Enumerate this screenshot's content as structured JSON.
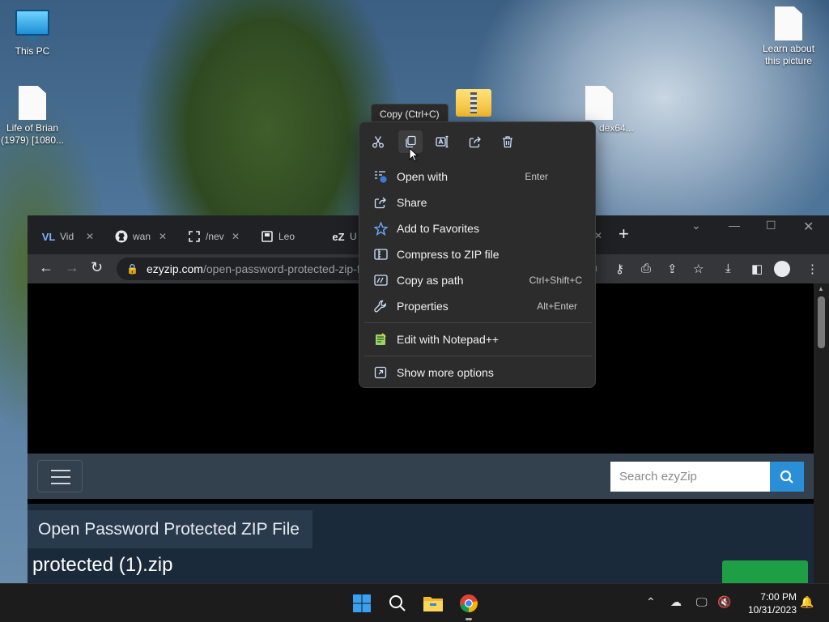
{
  "desktop": {
    "icons": [
      {
        "label": "This PC"
      },
      {
        "label": "Life of Brian (1979) [1080..."
      },
      {
        "label": "dex64..."
      },
      {
        "label": "Learn about this picture"
      }
    ]
  },
  "tooltip": "Copy (Ctrl+C)",
  "context_menu": {
    "quick_actions": [
      "cut-icon",
      "copy-icon",
      "rename-icon",
      "share-icon",
      "delete-icon"
    ],
    "items": [
      {
        "label": "Open with",
        "shortcut": "Enter"
      },
      {
        "label": "Share",
        "shortcut": ""
      },
      {
        "label": "Add to Favorites",
        "shortcut": ""
      },
      {
        "label": "Compress to ZIP file",
        "shortcut": ""
      },
      {
        "label": "Copy as path",
        "shortcut": "Ctrl+Shift+C"
      },
      {
        "label": "Properties",
        "shortcut": "Alt+Enter"
      },
      {
        "label": "Edit with Notepad++",
        "shortcut": ""
      },
      {
        "label": "Show more options",
        "shortcut": ""
      }
    ]
  },
  "browser": {
    "tabs": [
      {
        "favicon": "VL",
        "label": "Vid"
      },
      {
        "favicon": "github-icon",
        "label": "wan"
      },
      {
        "favicon": "expand-icon",
        "label": "/nev"
      },
      {
        "favicon": "doc-icon",
        "label": "Leo"
      },
      {
        "favicon": "eZ",
        "label": "U"
      }
    ],
    "url_host": "ezyzip.com",
    "url_path": "/open-password-protected-zip-f",
    "site": {
      "search_placeholder": "Search ezyZip",
      "title": "Open Password Protected ZIP File",
      "subtitle": "protected (1).zip"
    }
  },
  "taskbar": {
    "time": "7:00 PM",
    "date": "10/31/2023"
  },
  "colors": {
    "accent": "#2a8fd6",
    "menu_bg": "#2c2c2c",
    "taskbar_bg": "#1c1c1c",
    "favorite_star": "#6aa9ff"
  }
}
